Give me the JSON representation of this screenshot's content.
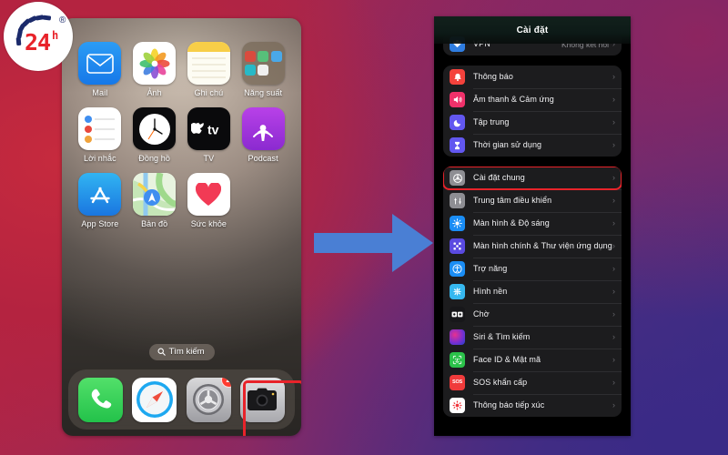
{
  "logo": {
    "text": "24",
    "sup": "h",
    "registered": "®",
    "color": "#e8232a",
    "arc_color": "#1b2a6b"
  },
  "arrow": {
    "name": "right-arrow",
    "color": "#4a7fd4"
  },
  "phone": {
    "apps": [
      {
        "label": "Mail",
        "icon": "mail-icon"
      },
      {
        "label": "Ảnh",
        "icon": "photos-icon"
      },
      {
        "label": "Ghi chú",
        "icon": "notes-icon"
      },
      {
        "label": "Năng suất",
        "icon": "folder-icon"
      },
      {
        "label": "Lời nhắc",
        "icon": "reminders-icon"
      },
      {
        "label": "Đồng hồ",
        "icon": "clock-icon"
      },
      {
        "label": "TV",
        "icon": "appletv-icon"
      },
      {
        "label": "Podcast",
        "icon": "podcasts-icon"
      },
      {
        "label": "App Store",
        "icon": "appstore-icon"
      },
      {
        "label": "Bản đồ",
        "icon": "maps-icon"
      },
      {
        "label": "Sức khỏe",
        "icon": "health-icon"
      }
    ],
    "search": {
      "label": "Tìm kiếm",
      "icon": "search-icon"
    },
    "dock": [
      {
        "label": "Phone",
        "icon": "phone-icon"
      },
      {
        "label": "Safari",
        "icon": "safari-icon"
      },
      {
        "label": "Cài đặt",
        "icon": "settings-gear-icon",
        "badge": "2",
        "highlighted": true
      },
      {
        "label": "Camera",
        "icon": "camera-icon"
      }
    ]
  },
  "settings": {
    "title": "Cài đặt",
    "groups": [
      {
        "rows": [
          {
            "label": "VPN",
            "value": "Không kết nối",
            "icon": "vpn-icon",
            "icon_color": "#2f7de1",
            "chevron": "›"
          }
        ]
      },
      {
        "rows": [
          {
            "label": "Thông báo",
            "icon": "notifications-icon",
            "icon_color": "#f4423c",
            "chevron": "›"
          },
          {
            "label": "Âm thanh & Cảm ứng",
            "icon": "sounds-icon",
            "icon_color": "#f0316a",
            "chevron": "›"
          },
          {
            "label": "Tập trung",
            "icon": "focus-icon",
            "icon_color": "#6257f0",
            "chevron": "›"
          },
          {
            "label": "Thời gian sử dụng",
            "icon": "screentime-icon",
            "icon_color": "#6257f0",
            "chevron": "›"
          }
        ]
      },
      {
        "rows": [
          {
            "label": "Cài đặt chung",
            "icon": "general-gear-icon",
            "icon_color": "#8e8e93",
            "chevron": "›",
            "highlighted": true
          },
          {
            "label": "Trung tâm điều khiển",
            "icon": "control-center-icon",
            "icon_color": "#8e8e93",
            "chevron": "›"
          },
          {
            "label": "Màn hình & Độ sáng",
            "icon": "display-icon",
            "icon_color": "#1a8df5",
            "chevron": "›"
          },
          {
            "label": "Màn hình chính & Thư viện ứng dụng",
            "icon": "home-screen-icon",
            "icon_color": "#5a4ae0",
            "chevron": "›"
          },
          {
            "label": "Trợ năng",
            "icon": "accessibility-icon",
            "icon_color": "#1a8df5",
            "chevron": "›"
          },
          {
            "label": "Hình nền",
            "icon": "wallpaper-icon",
            "icon_color": "#36b8ef",
            "chevron": "›"
          },
          {
            "label": "Chờ",
            "icon": "standby-icon",
            "icon_color": "#17171a",
            "chevron": "›"
          },
          {
            "label": "Siri & Tìm kiếm",
            "icon": "siri-icon",
            "icon_color": "#2b2b66",
            "chevron": "›"
          },
          {
            "label": "Face ID & Mật mã",
            "icon": "faceid-icon",
            "icon_color": "#2bc24a",
            "chevron": "›"
          },
          {
            "label": "SOS khẩn cấp",
            "icon": "sos-icon",
            "icon_color": "#f03b3b",
            "chevron": "›"
          },
          {
            "label": "Thông báo tiếp xúc",
            "icon": "exposure-icon",
            "icon_color": "#ffffff",
            "chevron": "›"
          }
        ]
      }
    ]
  }
}
